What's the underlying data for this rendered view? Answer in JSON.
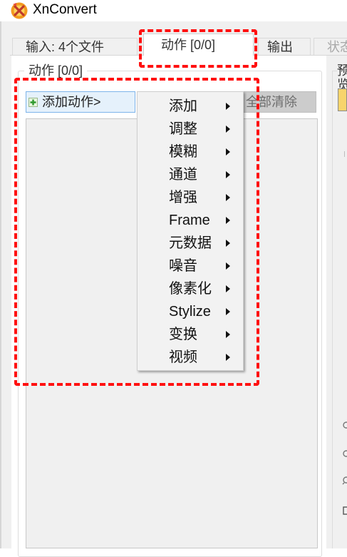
{
  "window": {
    "title": "XnConvert",
    "logo_icon": "xnconvert-logo-icon"
  },
  "tabs": [
    {
      "id": "input",
      "label": "输入:  4个文件"
    },
    {
      "id": "actions",
      "label": "动作 [0/0]",
      "selected": true
    },
    {
      "id": "output",
      "label": "输出"
    },
    {
      "id": "status",
      "label": "状态",
      "disabled": true
    }
  ],
  "actions_panel": {
    "group_title": "动作 [0/0]",
    "add_action_label": "添加动作>",
    "add_icon": "green-plus-icon",
    "clear_all_label": "全部清除"
  },
  "preview_panel": {
    "group_title": "预览"
  },
  "context_menu": {
    "items": [
      {
        "label": "添加",
        "submenu": true
      },
      {
        "label": "调整",
        "submenu": true
      },
      {
        "label": "模糊",
        "submenu": true
      },
      {
        "label": "通道",
        "submenu": true
      },
      {
        "label": "增强",
        "submenu": true
      },
      {
        "label": "Frame",
        "submenu": true
      },
      {
        "label": "元数据",
        "submenu": true
      },
      {
        "label": "噪音",
        "submenu": true
      },
      {
        "label": "像素化",
        "submenu": true
      },
      {
        "label": "Stylize",
        "submenu": true
      },
      {
        "label": "变换",
        "submenu": true
      },
      {
        "label": "视频",
        "submenu": true
      }
    ]
  },
  "annotations": {
    "highlight_color": "#ff1010"
  },
  "colors": {
    "window_bg": "#f0f0f0",
    "button_hover_bg": "#e5f1fb",
    "button_hover_border": "#7eb4ea",
    "disabled_button_bg": "#cccccc"
  }
}
